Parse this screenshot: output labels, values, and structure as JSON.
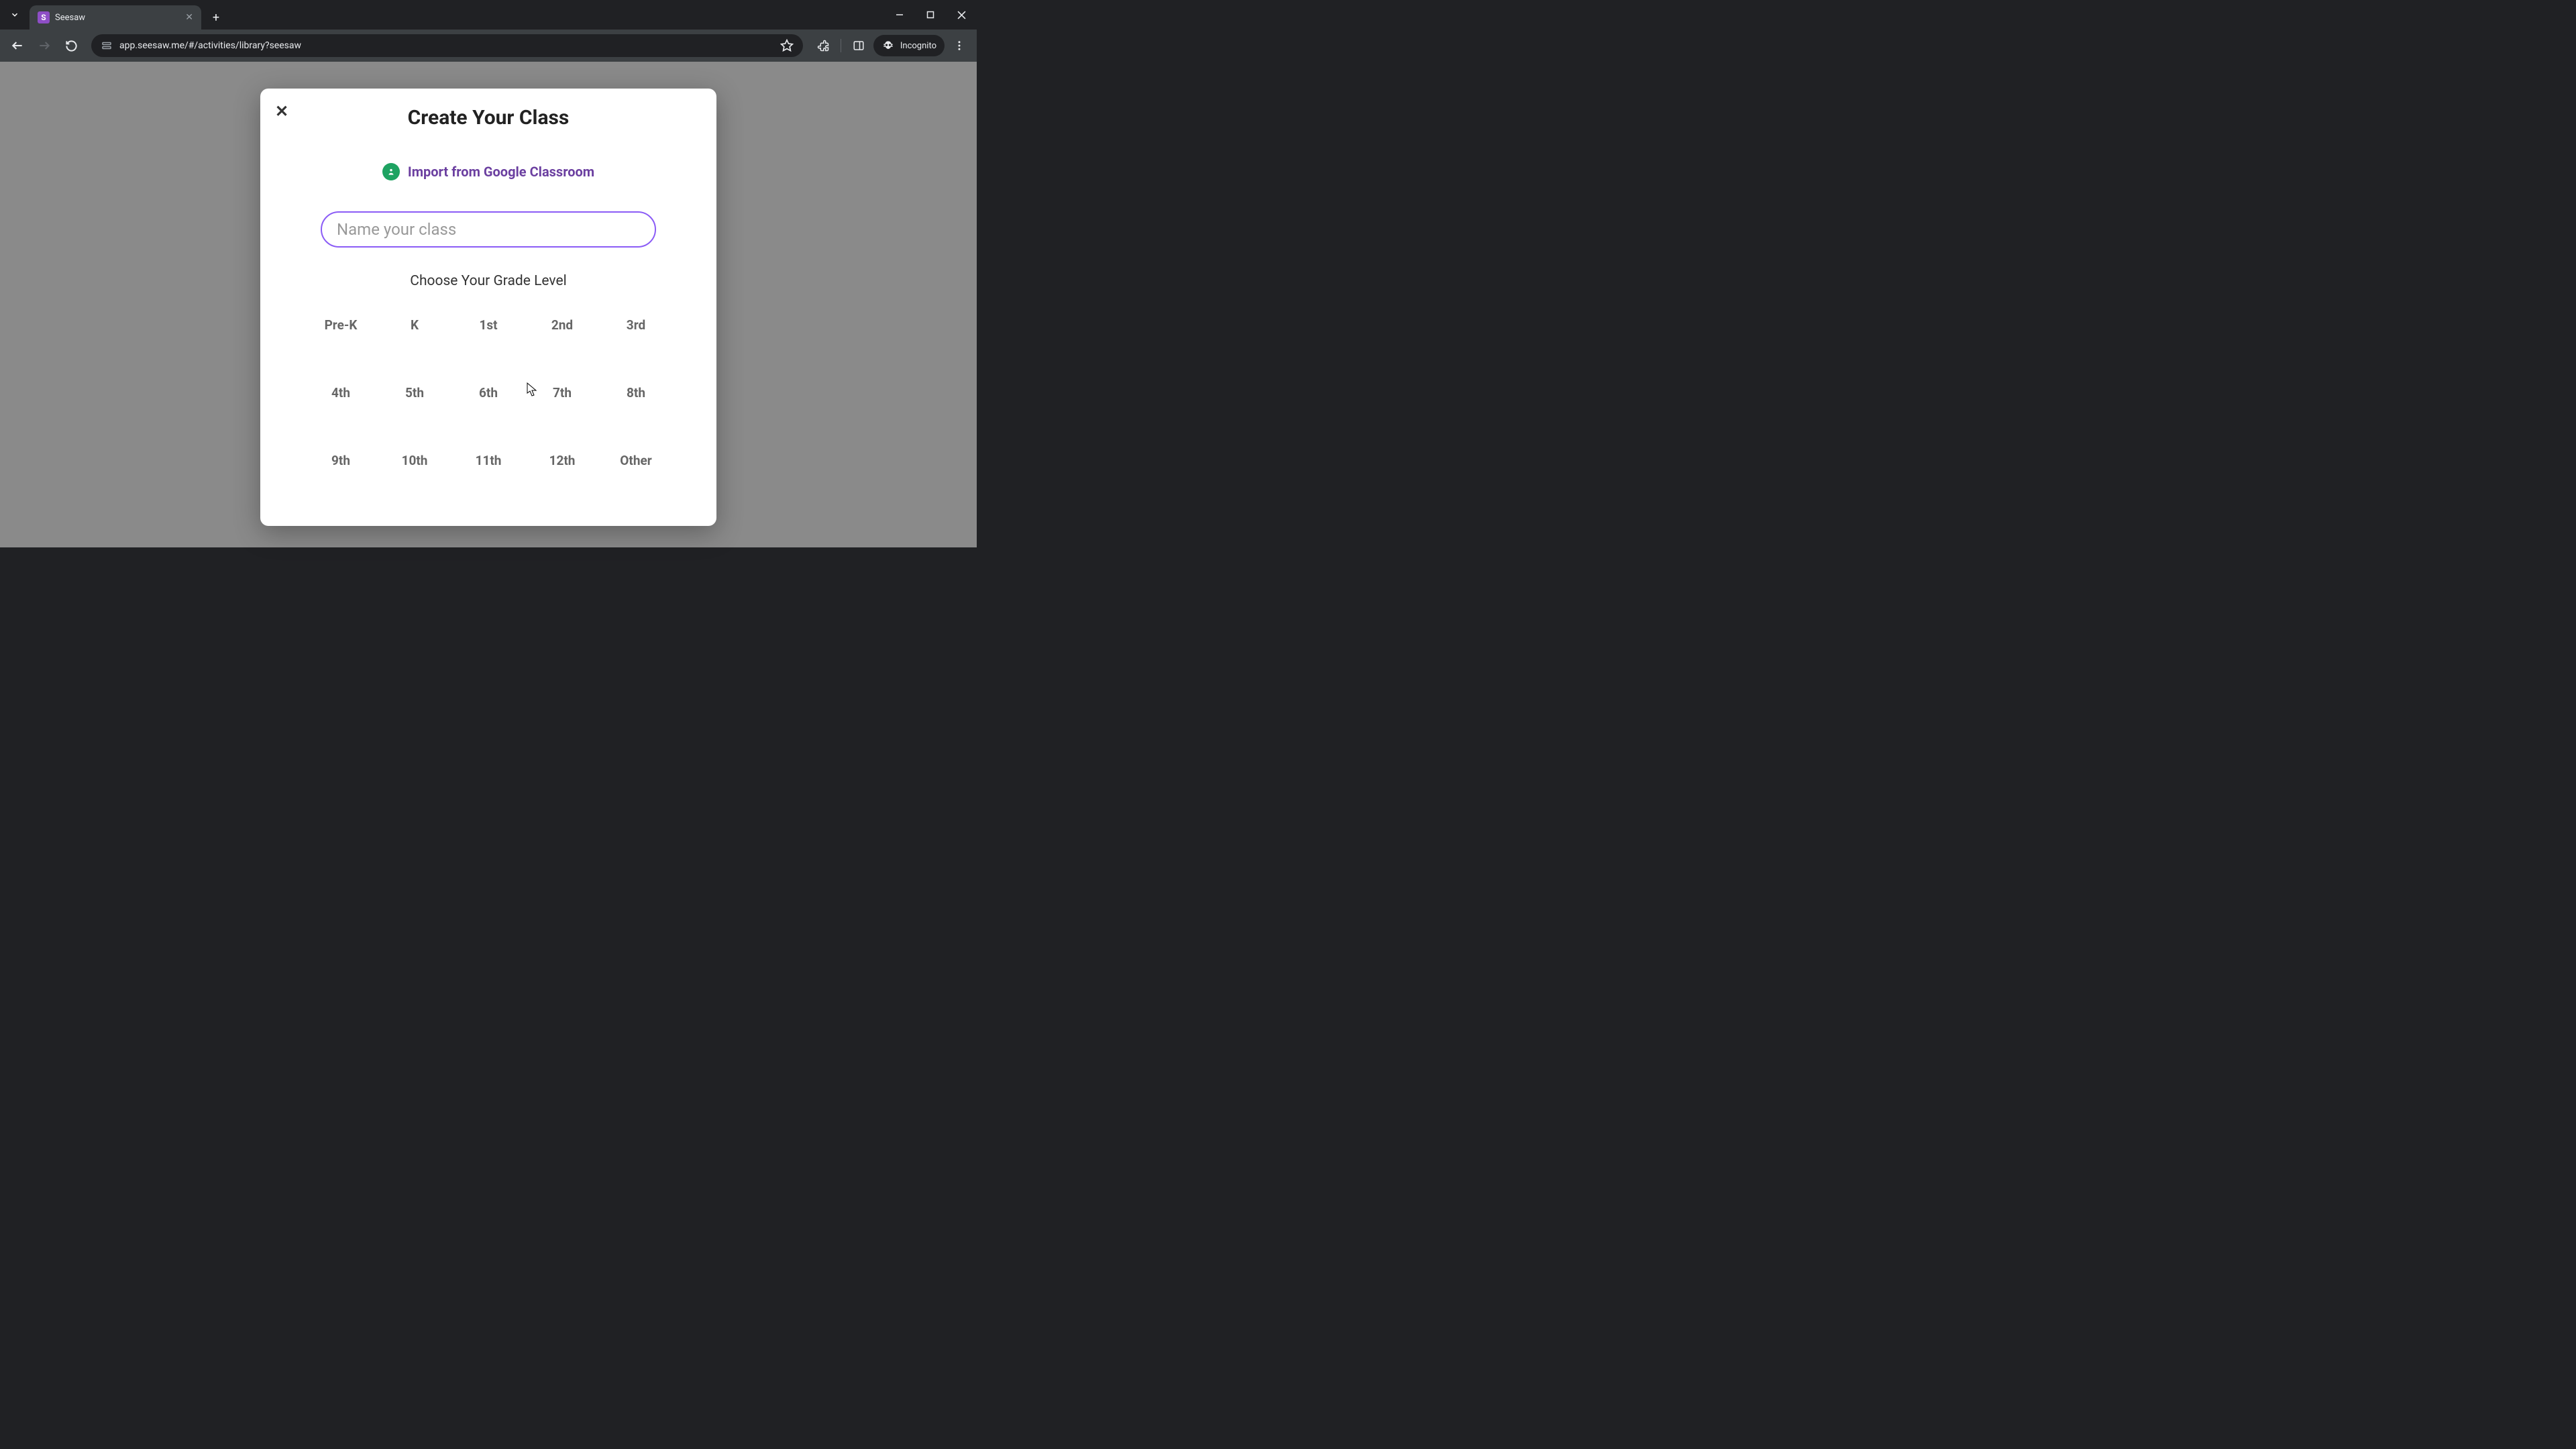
{
  "browser": {
    "tab_title": "Seesaw",
    "url_display": "app.seesaw.me/#/activities/library?seesaw",
    "incognito_label": "Incognito"
  },
  "modal": {
    "title": "Create Your Class",
    "import_label": "Import from Google Classroom",
    "class_name_placeholder": "Name your class",
    "class_name_value": "",
    "grade_heading": "Choose Your Grade Level",
    "grades": [
      "Pre-K",
      "K",
      "1st",
      "2nd",
      "3rd",
      "4th",
      "5th",
      "6th",
      "7th",
      "8th",
      "9th",
      "10th",
      "11th",
      "12th",
      "Other"
    ]
  }
}
